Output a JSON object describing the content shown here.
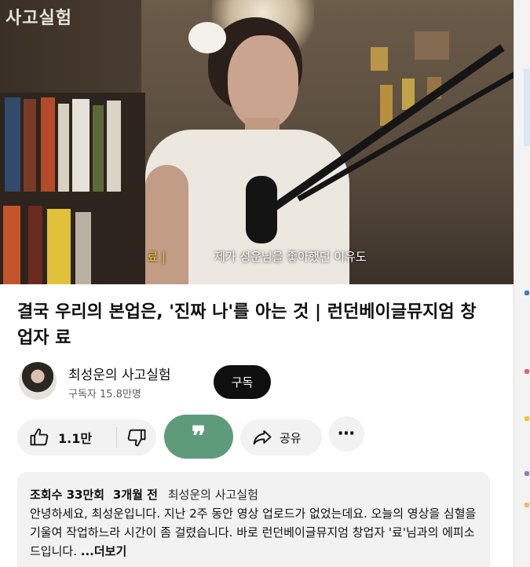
{
  "video": {
    "logo": "사고실험",
    "caption_speaker": "료 |",
    "caption_text": "제가 성운님을 좋아했던 이유도"
  },
  "title": "결국 우리의 본업은, '진짜 나'를 아는 것 | 런던베이글뮤지엄 창업자 료",
  "channel": {
    "name": "최성운의 사고실험",
    "subscribers": "구독자 15.8만명",
    "subscribe_label": "구독"
  },
  "actions": {
    "like_count": "1.1만",
    "quote_glyph": "❞",
    "share_label": "공유",
    "more_glyph": "⋯"
  },
  "description": {
    "views": "조회수 33만회",
    "age": "3개월 전",
    "channel": "최성운의 사고실험",
    "text": "안녕하세요, 최성운입니다. 지난 2주 동안 영상 업로드가 없었는데요. 오늘의 영상을 심혈을 기울여 작업하느라 시간이 좀 걸렸습니다. 바로 런던베이글뮤지엄 창업자 '료'님과의 에피소드입니다. ",
    "more": "...더보기"
  },
  "colors": {
    "quote_button": "#5e9b7b",
    "subscribe_bg": "#0f0f0f",
    "caption_speaker": "#f4c21a",
    "pill_bg": "#f2f2f2"
  },
  "icons": [
    "like-icon",
    "dislike-icon",
    "quote-icon",
    "share-icon",
    "more-icon"
  ]
}
